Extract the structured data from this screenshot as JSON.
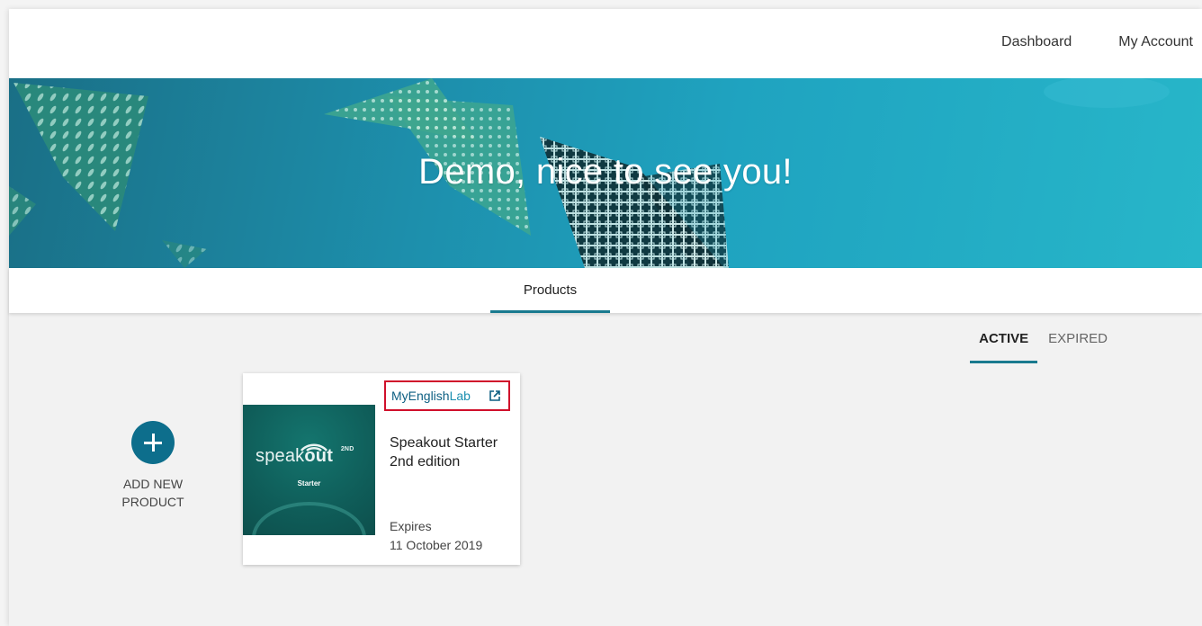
{
  "topnav": {
    "dashboard": "Dashboard",
    "my_account": "My Account"
  },
  "hero": {
    "greeting": "Demo, nice to see you!"
  },
  "tabs": {
    "products": "Products"
  },
  "filters": {
    "active": "ACTIVE",
    "expired": "EXPIRED"
  },
  "add_product": {
    "label": "ADD NEW PRODUCT",
    "icon": "plus-icon"
  },
  "product": {
    "brand_part1": "MyEnglish",
    "brand_part2": "Lab",
    "cover_title_part1": "speak",
    "cover_title_part2": "out",
    "cover_edition": "2ND",
    "cover_subtitle": "Starter",
    "title": "Speakout Starter 2nd edition",
    "expires_label": "Expires",
    "expires_date": "11 October 2019",
    "external_icon": "external-link-icon"
  },
  "colors": {
    "accent": "#197a8f",
    "add_button": "#0d6e8c",
    "highlight_box": "#d0102b",
    "brand": "#0d5f82"
  }
}
